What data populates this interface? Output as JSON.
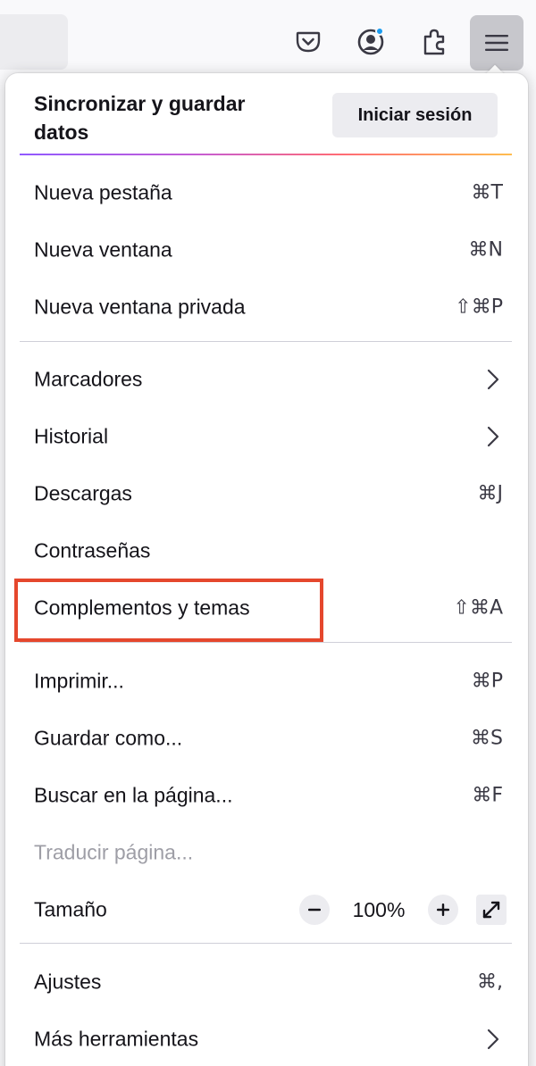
{
  "toolbar": {
    "icons": [
      "pocket-icon",
      "account-icon",
      "extensions-icon",
      "hamburger-menu-icon"
    ],
    "badge_color": "#1a9cf0"
  },
  "panel": {
    "sync_title": "Sincronizar y guardar datos",
    "sign_in_label": "Iniciar sesión",
    "items": [
      {
        "label": "Nueva pestaña",
        "shortcut": "⌘T"
      },
      {
        "label": "Nueva ventana",
        "shortcut": "⌘N"
      },
      {
        "label": "Nueva ventana privada",
        "shortcut": "⇧⌘P"
      },
      {
        "label": "Marcadores",
        "shortcut": ""
      },
      {
        "label": "Historial",
        "shortcut": ""
      },
      {
        "label": "Descargas",
        "shortcut": "⌘J"
      },
      {
        "label": "Contraseñas",
        "shortcut": ""
      },
      {
        "label": "Complementos y temas",
        "shortcut": "⇧⌘A"
      },
      {
        "label": "Imprimir...",
        "shortcut": "⌘P"
      },
      {
        "label": "Guardar como...",
        "shortcut": "⌘S"
      },
      {
        "label": "Buscar en la página...",
        "shortcut": "⌘F"
      },
      {
        "label": "Traducir página...",
        "shortcut": ""
      },
      {
        "label": "Tamaño",
        "shortcut": ""
      },
      {
        "label": "Ajustes",
        "shortcut": "⌘,"
      },
      {
        "label": "Más herramientas",
        "shortcut": ""
      }
    ],
    "zoom": {
      "minus": "−",
      "value": "100%",
      "plus": "+"
    }
  },
  "colors": {
    "highlight": "#e5472d",
    "gradient": [
      "#9059ff",
      "#c45cd6",
      "#ff6a75",
      "#ffbd4f"
    ]
  }
}
